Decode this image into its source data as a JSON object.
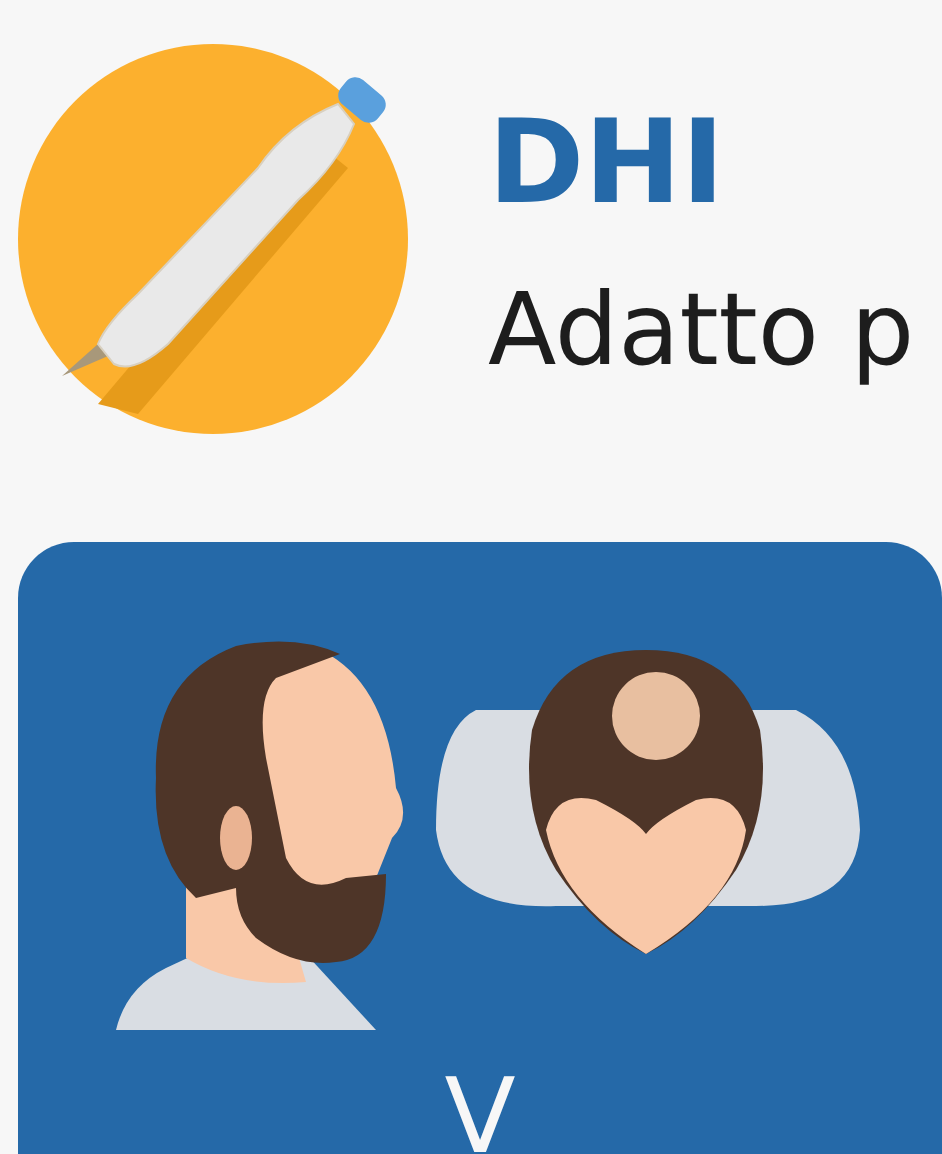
{
  "header": {
    "title": "DHI",
    "subtitle": "Adatto p"
  },
  "card": {
    "title": "V"
  }
}
